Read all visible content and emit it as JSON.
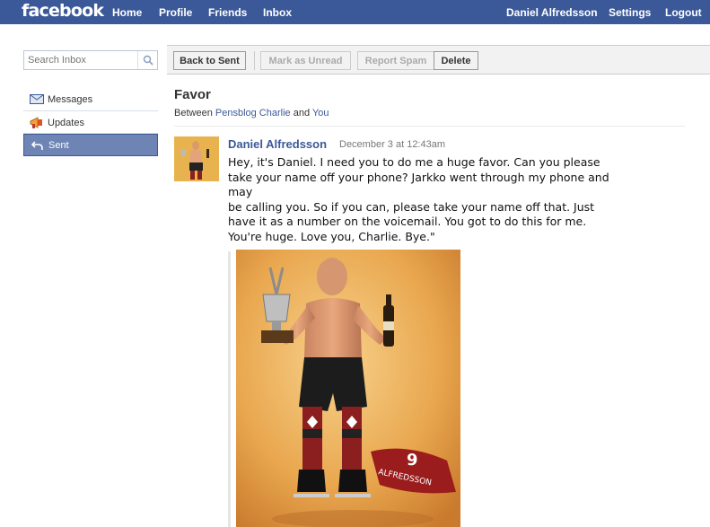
{
  "topbar": {
    "logo": "facebook",
    "nav": [
      "Home",
      "Profile",
      "Friends",
      "Inbox"
    ],
    "user_name": "Daniel Alfredsson",
    "settings": "Settings",
    "logout": "Logout"
  },
  "sidebar": {
    "search_placeholder": "Search Inbox",
    "items": [
      {
        "label": "Messages",
        "icon": "envelope-icon"
      },
      {
        "label": "Updates",
        "icon": "megaphone-icon"
      },
      {
        "label": "Sent",
        "icon": "sent-arrow-icon",
        "active": true
      }
    ]
  },
  "toolbar": {
    "back": "Back to Sent",
    "mark_unread": "Mark as Unread",
    "report_spam": "Report Spam",
    "delete": "Delete"
  },
  "thread": {
    "subject": "Favor",
    "between_prefix": "Between",
    "participant_1": "Pensblog Charlie",
    "and": "and",
    "participant_2": "You"
  },
  "message": {
    "sender": "Daniel Alfredsson",
    "date": "December 3 at 12:43am",
    "lines": [
      "Hey, it's Daniel. I need you to do me a huge favor. Can you please",
      "take your name off your phone? Jarkko went through my phone and",
      "may",
      "be calling you. So if you can, please take your name off that. Just",
      "have it as a number on the voicemail. You got to do this for me.",
      "You're huge. Love you, Charlie. Bye.\""
    ]
  },
  "colors": {
    "brand": "#3b5998",
    "sidebar_active": "#6d84b4",
    "link": "#3b5998"
  }
}
